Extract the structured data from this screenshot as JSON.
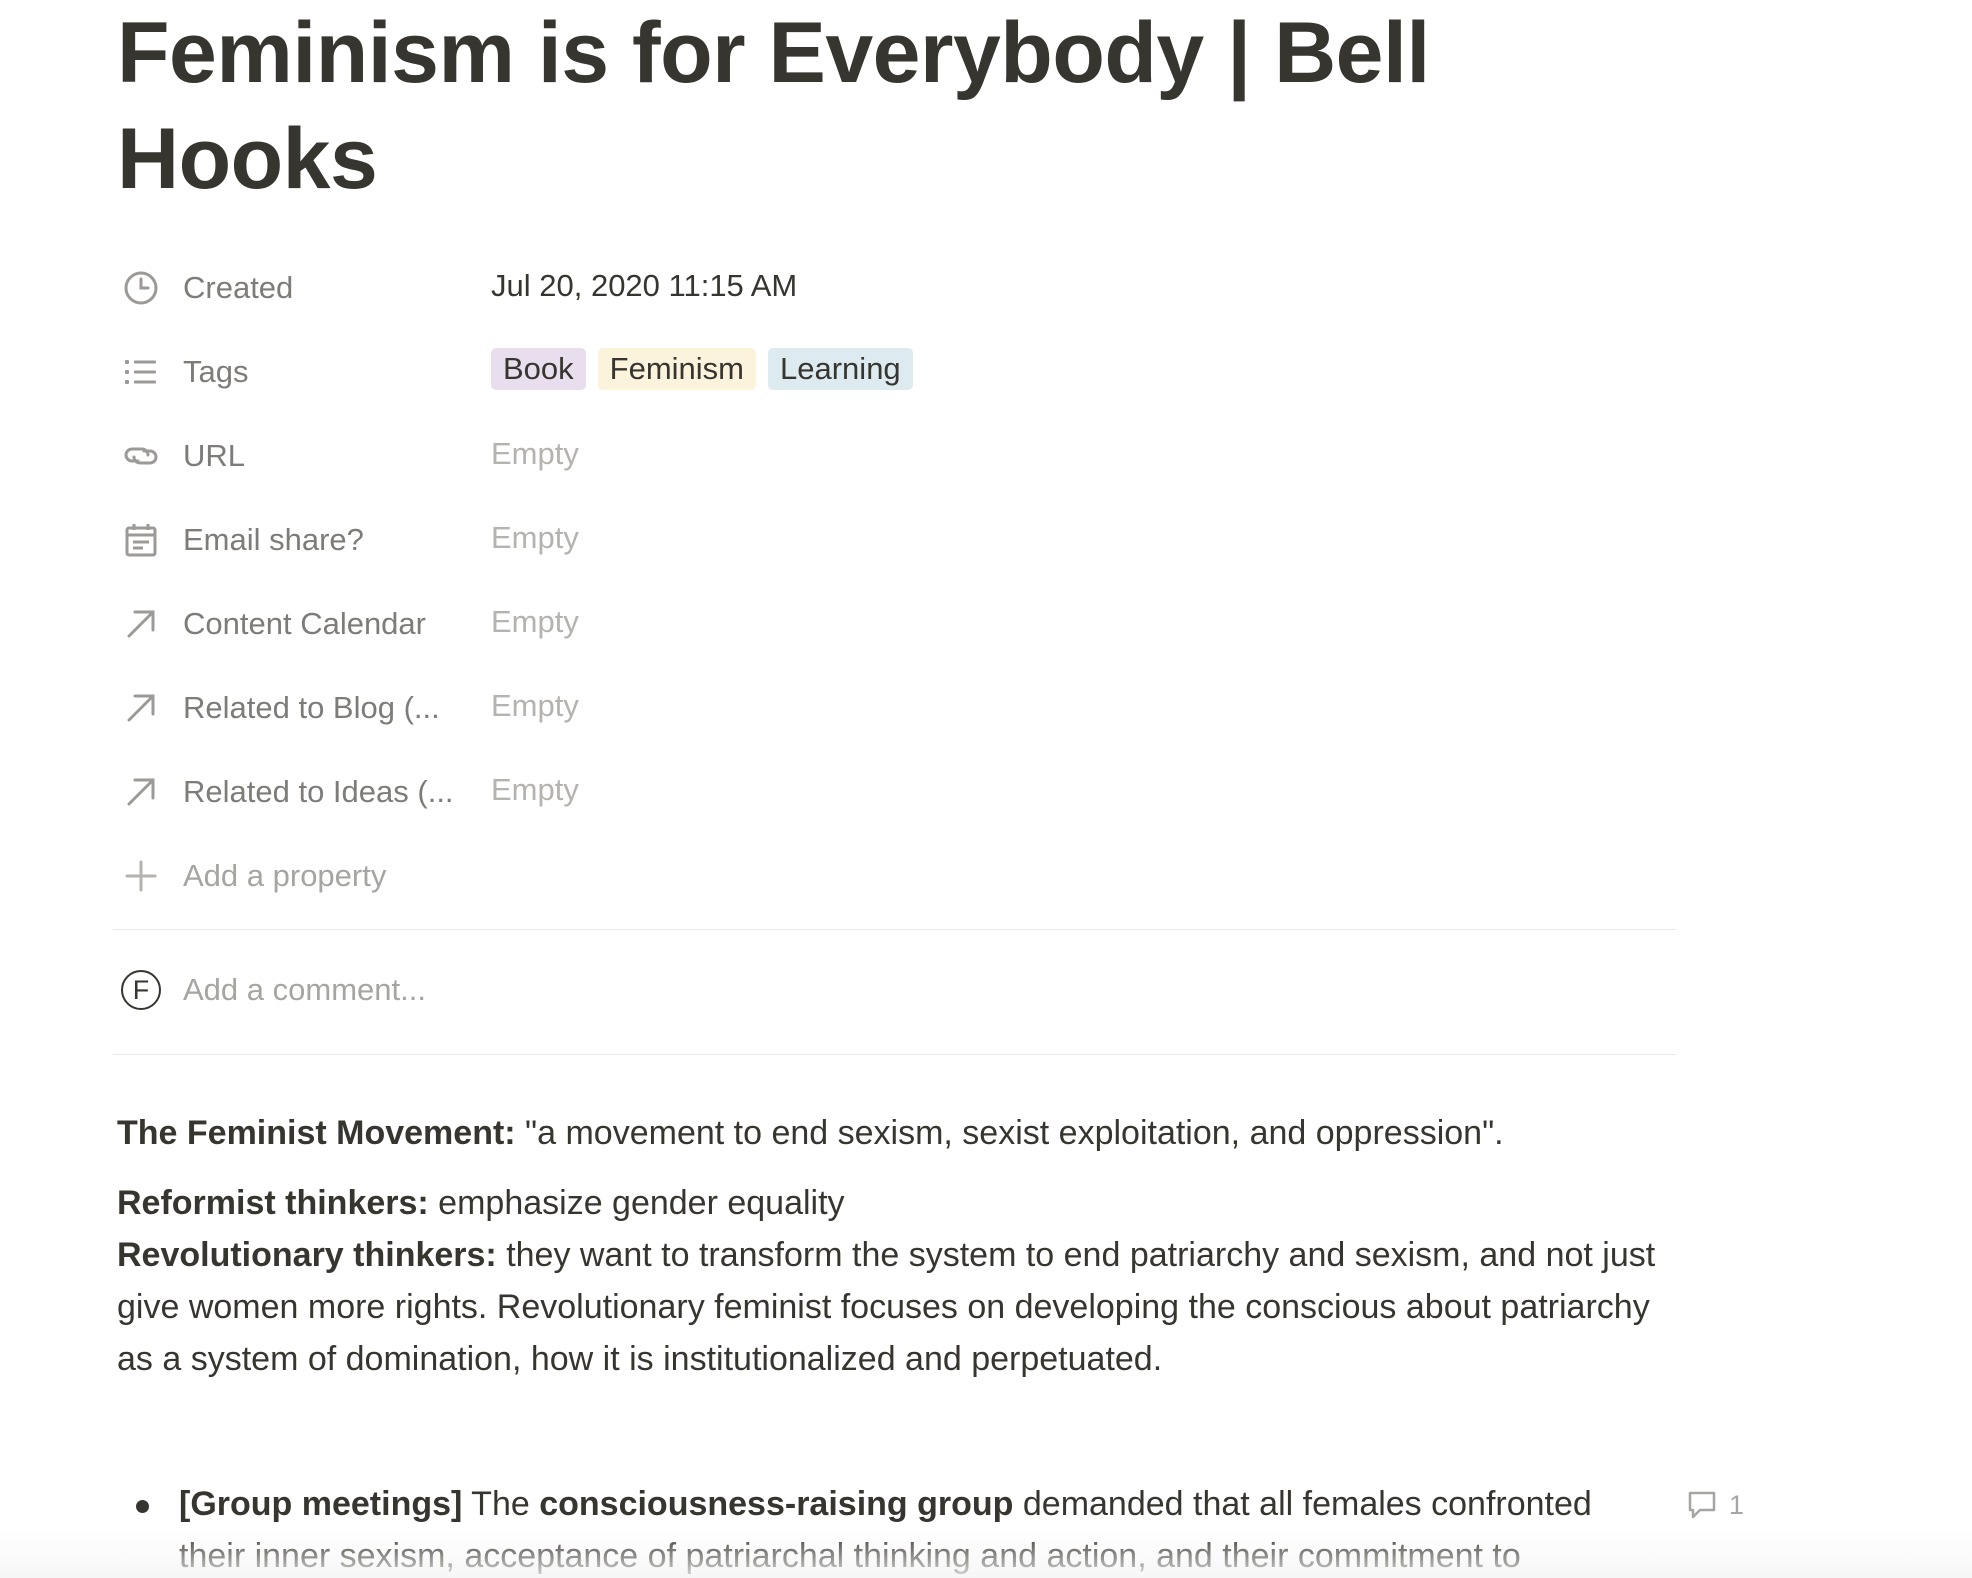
{
  "page": {
    "title": "Feminism is for Everybody | Bell Hooks"
  },
  "properties": [
    {
      "name": "Created",
      "icon": "clock-icon",
      "value": "Jul 20, 2020 11:15 AM"
    },
    {
      "name": "Tags",
      "icon": "list-icon"
    },
    {
      "name": "URL",
      "icon": "link-icon",
      "value": "Empty"
    },
    {
      "name": "Email share?",
      "icon": "calendar-icon",
      "value": "Empty"
    },
    {
      "name": "Content Calendar",
      "icon": "relation-arrow-icon",
      "value": "Empty"
    },
    {
      "name": "Related to Blog (...",
      "icon": "relation-arrow-icon",
      "value": "Empty"
    },
    {
      "name": "Related to Ideas (...",
      "icon": "relation-arrow-icon",
      "value": "Empty"
    }
  ],
  "tags": [
    {
      "label": "Book",
      "color": "#e8deee"
    },
    {
      "label": "Feminism",
      "color": "#fbf3db"
    },
    {
      "label": "Learning",
      "color": "#ddebf1"
    }
  ],
  "add_property_label": "Add a property",
  "comment": {
    "avatar_initial": "F",
    "placeholder": "Add a comment..."
  },
  "content": {
    "p1_bold": "The Feminist Movement:",
    "p1_text": " \"a movement to end sexism, sexist exploitation, and oppression\".",
    "p2_bold": "Reformist thinkers:",
    "p2_text": " emphasize gender equality",
    "p3_bold": "Revolutionary thinkers:",
    "p3_text": " they want to transform the system to end patriarchy and sexism, and not just give women more rights. Revolutionary feminist focuses on developing the conscious about patriarchy as a system of domination, how it is institutionalized and perpetuated.",
    "bullet_bold1": "[Group meetings]",
    "bullet_text1": " The ",
    "bullet_bold2": "consciousness-raising group",
    "bullet_text2": " demanded that all females confronted their inner sexism, acceptance of patriarchal thinking and action, and their commitment to",
    "bullet_comment_count": "1"
  }
}
